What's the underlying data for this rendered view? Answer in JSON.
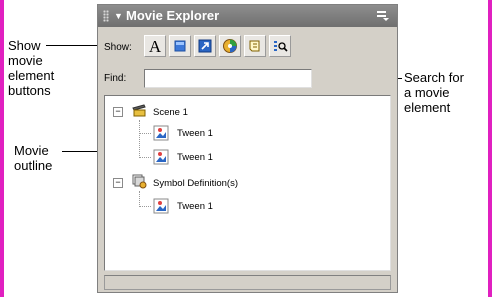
{
  "panel": {
    "title": "Movie Explorer",
    "show_label": "Show:",
    "find_label": "Find:",
    "find_value": "",
    "show_buttons": [
      {
        "icon": "text-icon",
        "glyph": "A"
      },
      {
        "icon": "button-icon"
      },
      {
        "icon": "action-icon"
      },
      {
        "icon": "video-sound-bitmap-icon"
      },
      {
        "icon": "frame-layer-icon"
      },
      {
        "icon": "customize-icon"
      }
    ],
    "outline": [
      {
        "label": "Scene 1",
        "children": [
          {
            "label": "Tween 1"
          },
          {
            "label": "Tween 1"
          }
        ]
      },
      {
        "label": "Symbol Definition(s)",
        "children": [
          {
            "label": "Tween 1"
          }
        ]
      }
    ]
  },
  "callouts": {
    "show_buttons": [
      "Show",
      "movie",
      "element",
      "buttons"
    ],
    "search": [
      "Search for",
      "a movie",
      "element"
    ],
    "outline": [
      "Movie",
      "outline"
    ]
  },
  "colors": {
    "page_edge": "#e020c0",
    "titlebar": "#7a7a7a",
    "panel_bg": "#d4d0c8"
  }
}
